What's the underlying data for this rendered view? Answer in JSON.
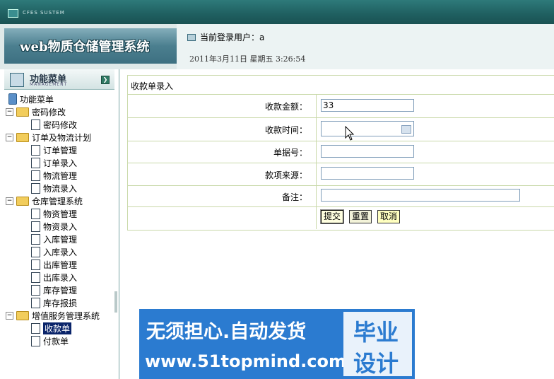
{
  "topbar": {
    "system_label": "CFES SUSTEM"
  },
  "banner": {
    "title": "web物质仓储管理系统"
  },
  "header": {
    "current_user_label": "当前登录用户：a",
    "datetime": "2011年3月11日  星期五  3:26:54"
  },
  "sidebar": {
    "title": "功能菜单",
    "subtitle": "MANAGEMENT",
    "collapse_btn": "❯",
    "tree": {
      "root": "功能菜单",
      "groups": [
        {
          "label": "密码修改",
          "toggle": "−",
          "items": [
            "密码修改"
          ]
        },
        {
          "label": "订单及物流计划",
          "toggle": "−",
          "items": [
            "订单管理",
            "订单录入",
            "物流管理",
            "物流录入"
          ]
        },
        {
          "label": "仓库管理系统",
          "toggle": "−",
          "items": [
            "物资管理",
            "物资录入",
            "入库管理",
            "入库录入",
            "出库管理",
            "出库录入",
            "库存管理",
            "库存报损"
          ]
        },
        {
          "label": "增值服务管理系统",
          "toggle": "−",
          "items": [
            "收款单",
            "付款单"
          ]
        }
      ],
      "selected": "收款单"
    }
  },
  "form": {
    "title": "收款单录入",
    "fields": [
      {
        "label": "收款金额：",
        "value": "33"
      },
      {
        "label": "收款时间：",
        "value": ""
      },
      {
        "label": "单据号：",
        "value": ""
      },
      {
        "label": "款项来源：",
        "value": ""
      },
      {
        "label": "备注：",
        "value": ""
      }
    ],
    "buttons": {
      "submit": "提交",
      "reset": "重置",
      "cancel": "取消"
    }
  },
  "watermark": {
    "line1": "无须担心.自动发货",
    "line2": "www.51topmind.com",
    "box_top": "毕业",
    "box_bottom": "设计"
  }
}
